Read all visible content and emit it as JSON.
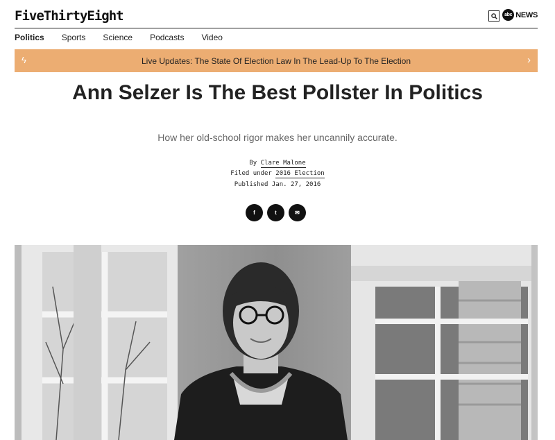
{
  "header": {
    "logo": "FiveThirtyEight",
    "partner_circle": "abc",
    "partner_text": "NEWS"
  },
  "nav": {
    "items": [
      "Politics",
      "Sports",
      "Science",
      "Podcasts",
      "Video"
    ]
  },
  "banner": {
    "text": "Live Updates: The State Of Election Law In The Lead-Up To The Election"
  },
  "article": {
    "title": "Ann Selzer Is The Best Pollster In Politics",
    "subtitle": "How her old-school rigor makes her uncannily accurate.",
    "by_prefix": "By",
    "author": "Clare Malone",
    "filed_prefix": "Filed under",
    "filed_topic": "2016 Election",
    "published": "Published Jan. 27, 2016"
  },
  "share": {
    "facebook": "f",
    "twitter": "t",
    "email": "✉"
  },
  "icons": {
    "bolt": "lightning-icon",
    "chevron": "chevron-right-icon",
    "search": "search-icon"
  },
  "colors": {
    "banner": "#ecad72",
    "text": "#222222"
  }
}
